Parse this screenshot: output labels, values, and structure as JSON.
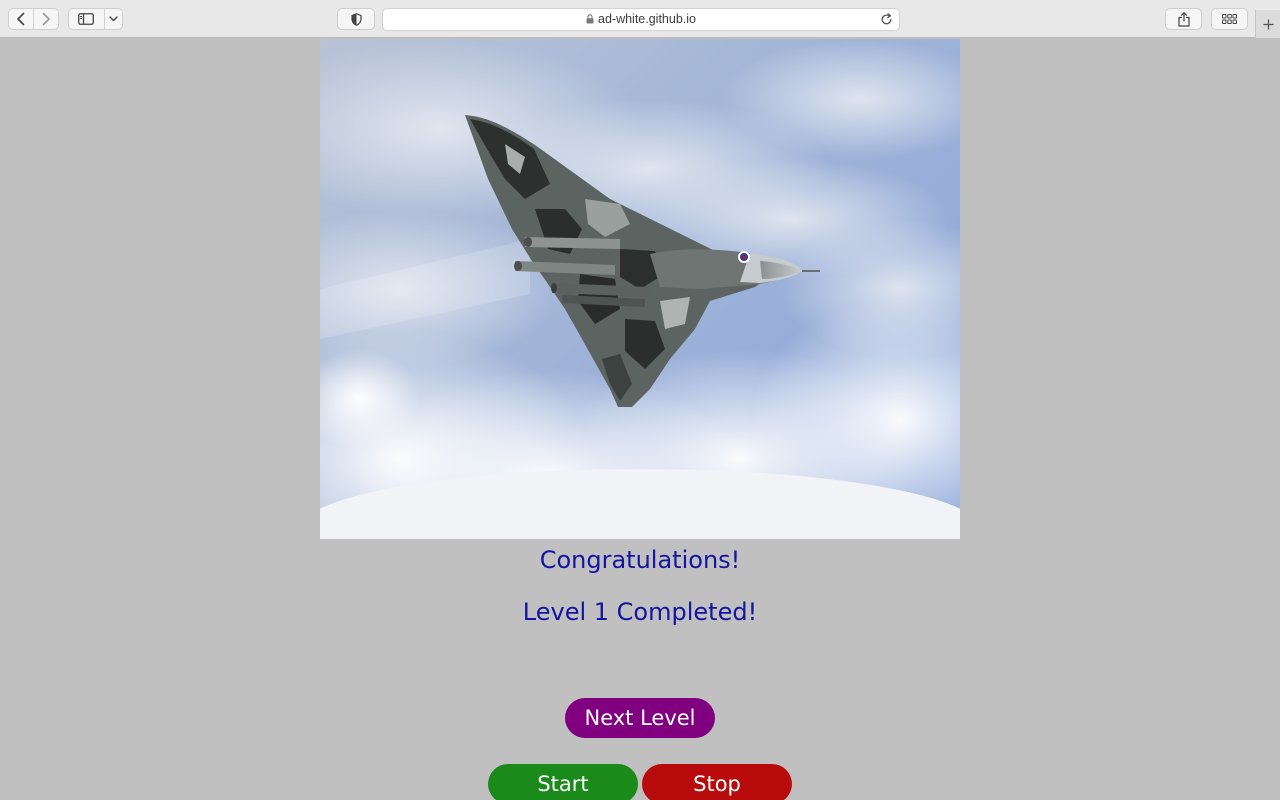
{
  "browser": {
    "url": "ad-white.github.io",
    "icons": {
      "back": "chevron-left-icon",
      "forward": "chevron-right-icon",
      "sidebar": "sidebar-icon",
      "privacy": "shield-icon",
      "lock": "lock-icon",
      "reload": "reload-icon",
      "share": "share-icon",
      "tabs": "tab-overview-icon",
      "new_tab": "plus-icon"
    }
  },
  "page": {
    "image": "delta-wing-jet-icon",
    "message_title": "Congratulations!",
    "message_level": "Level 1 Completed!",
    "next_level_label": "Next Level",
    "start_label": "Start",
    "stop_label": "Stop"
  },
  "colors": {
    "page_background": "#c0c0c0",
    "message_text": "#1414a0",
    "next_button": "#800080",
    "start_button": "#1a8a1a",
    "stop_button": "#b80c0c"
  }
}
